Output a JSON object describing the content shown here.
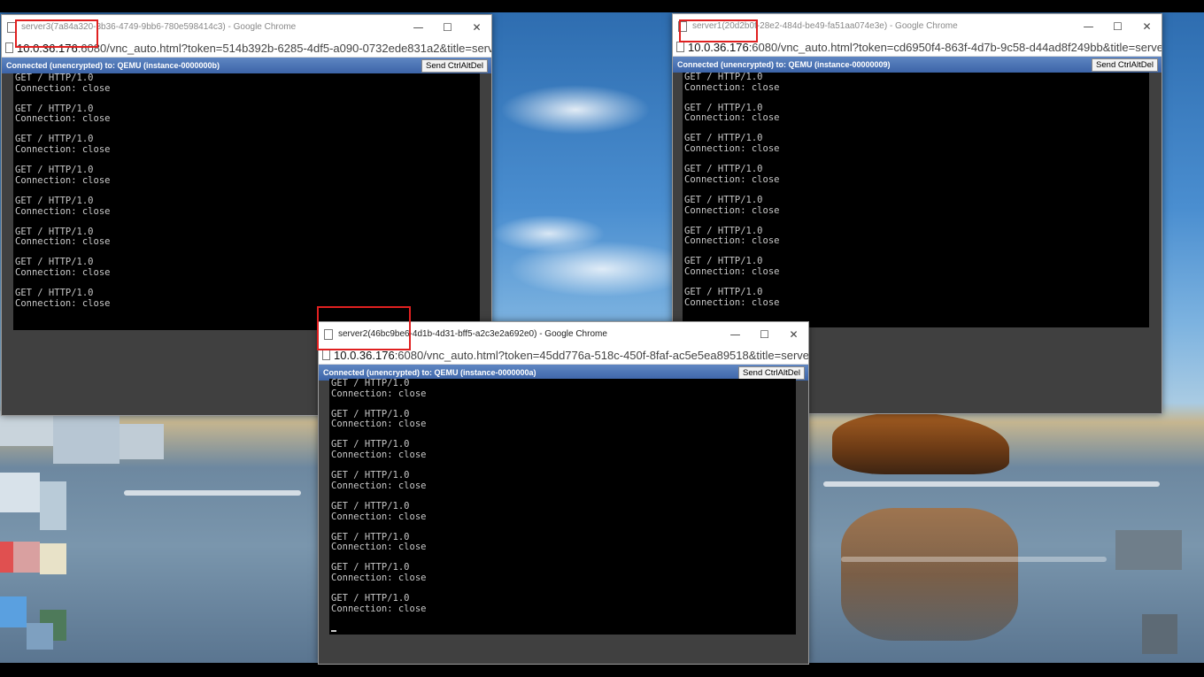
{
  "windows": {
    "server3": {
      "title": "server3(7a84a320-8b36-4749-9bb6-780e598414c3) - Google Chrome",
      "url_host": "10.0.36.176",
      "url_rest": ":6080/vnc_auto.html?token=514b392b-6285-4df5-a090-0732ede831a2&title=server",
      "status": "Connected (unencrypted) to: QEMU (instance-0000000b)",
      "button": "Send CtrlAltDel",
      "lines": [
        [
          "GET / HTTP/1.0",
          "Connection: close"
        ],
        [
          "GET / HTTP/1.0",
          "Connection: close"
        ],
        [
          "GET / HTTP/1.0",
          "Connection: close"
        ],
        [
          "GET / HTTP/1.0",
          "Connection: close"
        ],
        [
          "GET / HTTP/1.0",
          "Connection: close"
        ],
        [
          "GET / HTTP/1.0",
          "Connection: close"
        ],
        [
          "GET / HTTP/1.0",
          "Connection: close"
        ],
        [
          "GET / HTTP/1.0",
          "Connection: close"
        ]
      ]
    },
    "server1": {
      "title": "server1(20d2b0f-28e2-484d-be49-fa51aa074e3e) - Google Chrome",
      "url_host": "10.0.36.176",
      "url_rest": ":6080/vnc_auto.html?token=cd6950f4-863f-4d7b-9c58-d44ad8f249bb&title=server1",
      "status": "Connected (unencrypted) to: QEMU (instance-00000009)",
      "button": "Send CtrlAltDel",
      "lines": [
        [
          "GET / HTTP/1.0",
          "Connection: close"
        ],
        [
          "GET / HTTP/1.0",
          "Connection: close"
        ],
        [
          "GET / HTTP/1.0",
          "Connection: close"
        ],
        [
          "GET / HTTP/1.0",
          "Connection: close"
        ],
        [
          "GET / HTTP/1.0",
          "Connection: close"
        ],
        [
          "GET / HTTP/1.0",
          "Connection: close"
        ],
        [
          "GET / HTTP/1.0",
          "Connection: close"
        ],
        [
          "GET / HTTP/1.0",
          "Connection: close"
        ]
      ]
    },
    "server2": {
      "title": "server2(46bc9be6-4d1b-4d31-bff5-a2c3e2a692e0) - Google Chrome",
      "url_host": "10.0.36.176",
      "url_rest": ":6080/vnc_auto.html?token=45dd776a-518c-450f-8faf-ac5e5ea89518&title=server2",
      "status": "Connected (unencrypted) to: QEMU (instance-0000000a)",
      "button": "Send CtrlAltDel",
      "lines": [
        [
          "GET / HTTP/1.0",
          "Connection: close"
        ],
        [
          "GET / HTTP/1.0",
          "Connection: close"
        ],
        [
          "GET / HTTP/1.0",
          "Connection: close"
        ],
        [
          "GET / HTTP/1.0",
          "Connection: close"
        ],
        [
          "GET / HTTP/1.0",
          "Connection: close"
        ],
        [
          "GET / HTTP/1.0",
          "Connection: close"
        ],
        [
          "GET / HTTP/1.0",
          "Connection: close"
        ],
        [
          "GET / HTTP/1.0",
          "Connection: close"
        ]
      ]
    }
  },
  "controls": {
    "minimize": "—",
    "maximize": "☐",
    "close": "✕"
  },
  "colors": {
    "highlight": "#e02020",
    "vnc_bar": "#4a72b5",
    "terminal_bg": "#000000"
  }
}
